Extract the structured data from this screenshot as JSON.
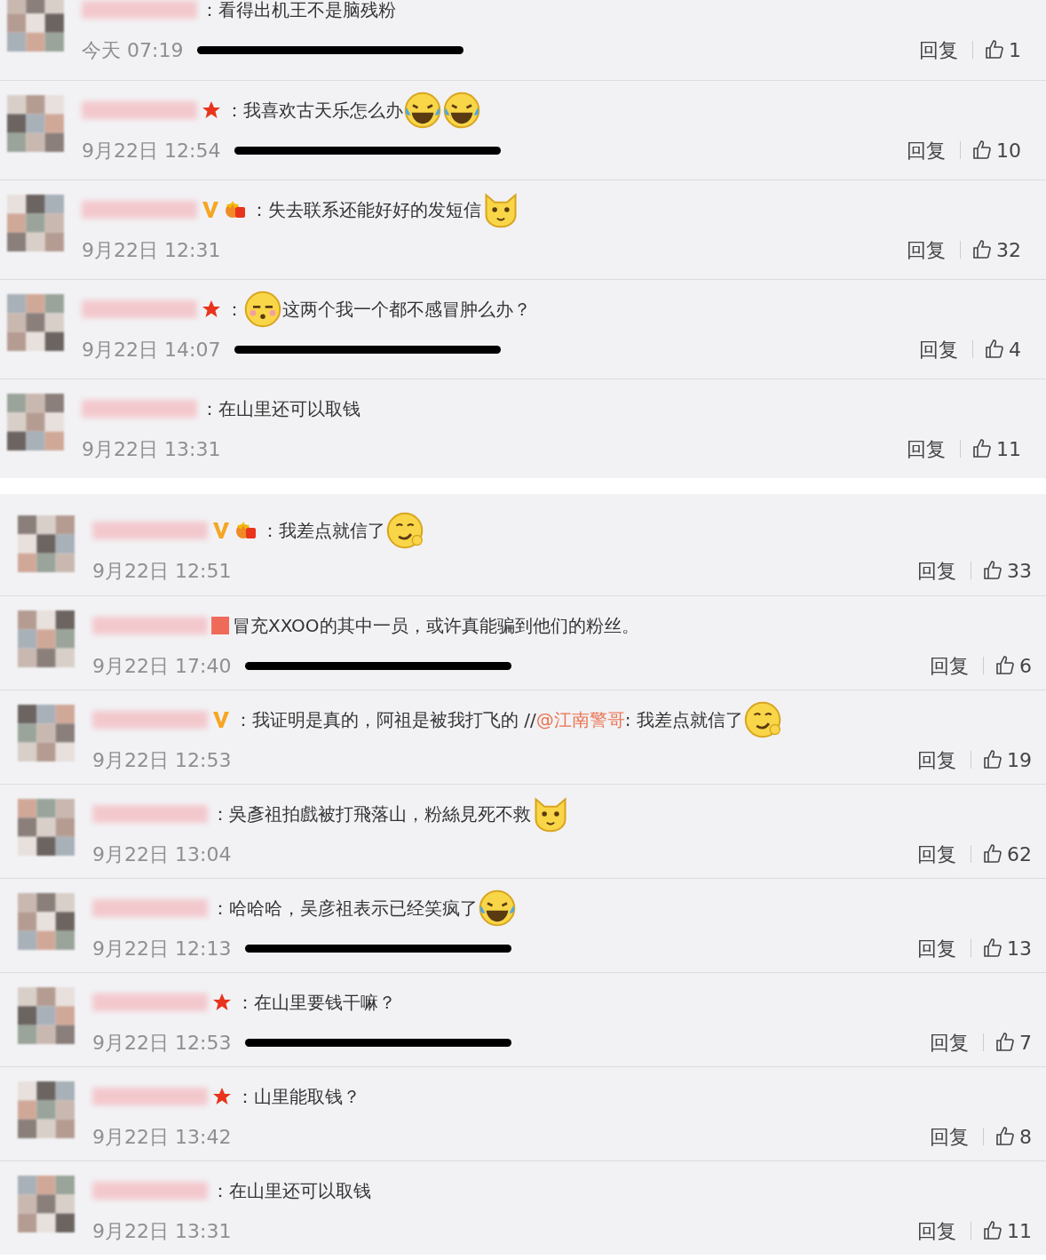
{
  "panels": [
    {
      "comments": [
        {
          "text": "：看得出机王不是脑残粉",
          "time": "今天 07:19",
          "redacted": true,
          "reply": "回复",
          "likes": "1"
        },
        {
          "badges": [
            {
              "kind": "star"
            }
          ],
          "text": "：我喜欢古天乐怎么办",
          "emoji": [
            {
              "kind": "laugh-cry"
            },
            {
              "kind": "laugh-cry"
            }
          ],
          "time": "9月22日 12:54",
          "redacted": true,
          "reply": "回复",
          "likes": "10"
        },
        {
          "badges": [
            {
              "kind": "v"
            },
            {
              "kind": "crown"
            }
          ],
          "text": "：失去联系还能好好的发短信",
          "emoji": [
            {
              "kind": "cat"
            }
          ],
          "time": "9月22日 12:31",
          "redacted": false,
          "reply": "回复",
          "likes": "32"
        },
        {
          "badges": [
            {
              "kind": "star"
            }
          ],
          "text": "：",
          "emoji": [
            {
              "kind": "shy"
            }
          ],
          "after": "这两个我一个都不感冒肿么办？",
          "time": "9月22日 14:07",
          "redacted": true,
          "reply": "回复",
          "likes": "4"
        },
        {
          "text": "：在山里还可以取钱",
          "time": "9月22日 13:31",
          "redacted": false,
          "reply": "回复",
          "likes": "11"
        }
      ]
    },
    {
      "comments": [
        {
          "badges": [
            {
              "kind": "v"
            },
            {
              "kind": "crown"
            }
          ],
          "text": "：我差点就信了",
          "emoji": [
            {
              "kind": "smirk"
            }
          ],
          "time": "9月22日 12:51",
          "redacted": false,
          "reply": "回复",
          "likes": "33"
        },
        {
          "badges": [
            {
              "kind": "square"
            }
          ],
          "text": "冒充XXOO的其中一员，或许真能骗到他们的粉丝。",
          "time": "9月22日 17:40",
          "redacted": true,
          "reply": "回复",
          "likes": "6"
        },
        {
          "badges": [
            {
              "kind": "v"
            }
          ],
          "text": "：我证明是真的，阿祖是被我打飞的 //",
          "link": "@江南警哥",
          "after": ": 我差点就信了",
          "end_emoji": [
            {
              "kind": "smirk"
            }
          ],
          "time": "9月22日 12:53",
          "redacted": false,
          "reply": "回复",
          "likes": "19"
        },
        {
          "text": "：吳彥祖拍戲被打飛落山，粉絲見死不救",
          "emoji": [
            {
              "kind": "cat"
            }
          ],
          "time": "9月22日 13:04",
          "redacted": false,
          "reply": "回复",
          "likes": "62"
        },
        {
          "text": "：哈哈哈，吴彦祖表示已经笑疯了",
          "emoji": [
            {
              "kind": "laugh-cry"
            }
          ],
          "time": "9月22日 12:13",
          "redacted": true,
          "reply": "回复",
          "likes": "13"
        },
        {
          "badges": [
            {
              "kind": "star"
            }
          ],
          "text": "：在山里要钱干嘛？",
          "time": "9月22日 12:53",
          "redacted": true,
          "reply": "回复",
          "likes": "7"
        },
        {
          "badges": [
            {
              "kind": "star"
            }
          ],
          "text": "：山里能取钱？",
          "time": "9月22日 13:42",
          "redacted": false,
          "reply": "回复",
          "likes": "8"
        },
        {
          "text": "：在山里还可以取钱",
          "time": "9月22日 13:31",
          "redacted": false,
          "reply": "回复",
          "likes": "11"
        }
      ]
    }
  ]
}
